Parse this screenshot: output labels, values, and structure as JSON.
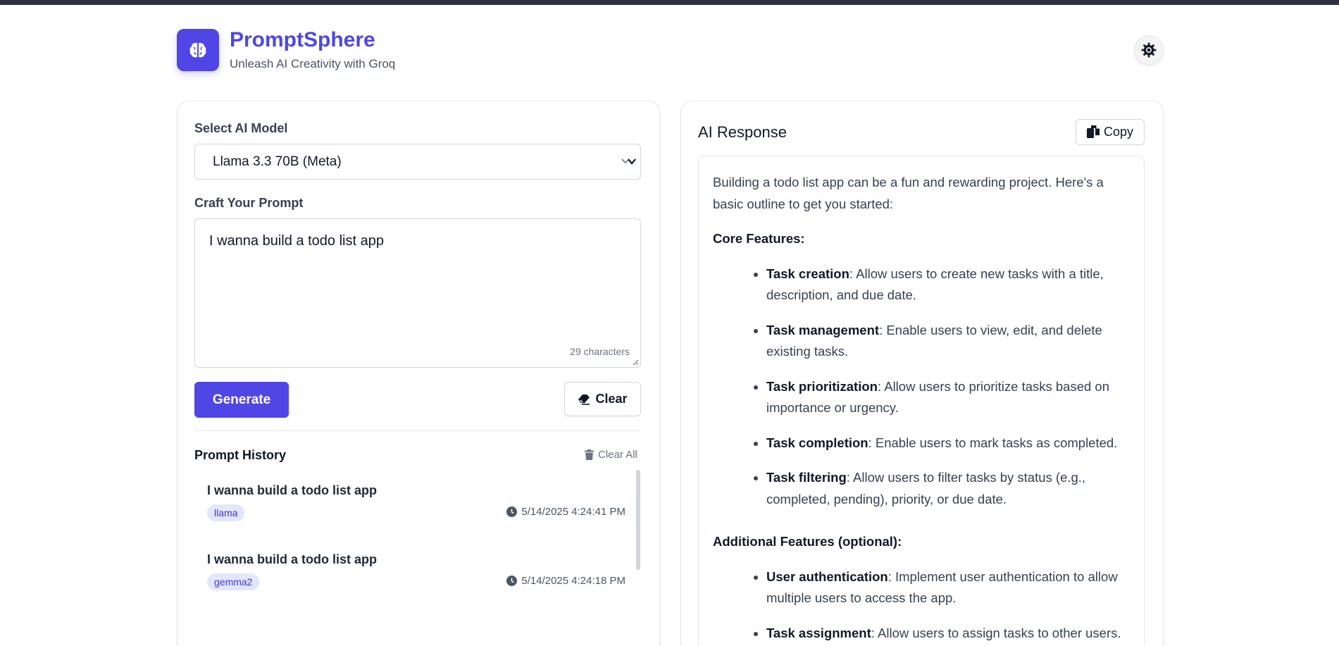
{
  "header": {
    "app_title": "PromptSphere",
    "app_subtitle": "Unleash AI Creativity with Groq",
    "logo_icon": "brain-icon",
    "theme_icon": "sun-icon"
  },
  "form": {
    "model_label": "Select AI Model",
    "model_selected": "Llama 3.3 70B (Meta)",
    "prompt_label": "Craft Your Prompt",
    "prompt_value": "I wanna build a todo list app",
    "char_count": "29 characters",
    "generate_label": "Generate",
    "clear_label": "Clear"
  },
  "history": {
    "title": "Prompt History",
    "clear_all_label": "Clear All",
    "items": [
      {
        "prompt": "I wanna build a todo list app",
        "model": "llama",
        "timestamp": "5/14/2025 4:24:41 PM"
      },
      {
        "prompt": "I wanna build a todo list app",
        "model": "gemma2",
        "timestamp": "5/14/2025 4:24:18 PM"
      }
    ]
  },
  "response": {
    "title": "AI Response",
    "copy_label": "Copy",
    "intro": "Building a todo list app can be a fun and rewarding project. Here's a basic outline to get you started:",
    "core_heading": "Core Features:",
    "core_items": [
      {
        "term": "Task creation",
        "desc": ": Allow users to create new tasks with a title, description, and due date."
      },
      {
        "term": "Task management",
        "desc": ": Enable users to view, edit, and delete existing tasks."
      },
      {
        "term": "Task prioritization",
        "desc": ": Allow users to prioritize tasks based on importance or urgency."
      },
      {
        "term": "Task completion",
        "desc": ": Enable users to mark tasks as completed."
      },
      {
        "term": "Task filtering",
        "desc": ": Allow users to filter tasks by status (e.g., completed, pending), priority, or due date."
      }
    ],
    "additional_heading": "Additional Features (optional):",
    "additional_items": [
      {
        "term": "User authentication",
        "desc": ": Implement user authentication to allow multiple users to access the app."
      },
      {
        "term": "Task assignment",
        "desc": ": Allow users to assign tasks to other users."
      }
    ]
  },
  "colors": {
    "accent": "#4f46e5",
    "topbar": "#2d3340",
    "badge_bg": "#e0e7ff",
    "badge_text": "#4338ca"
  }
}
